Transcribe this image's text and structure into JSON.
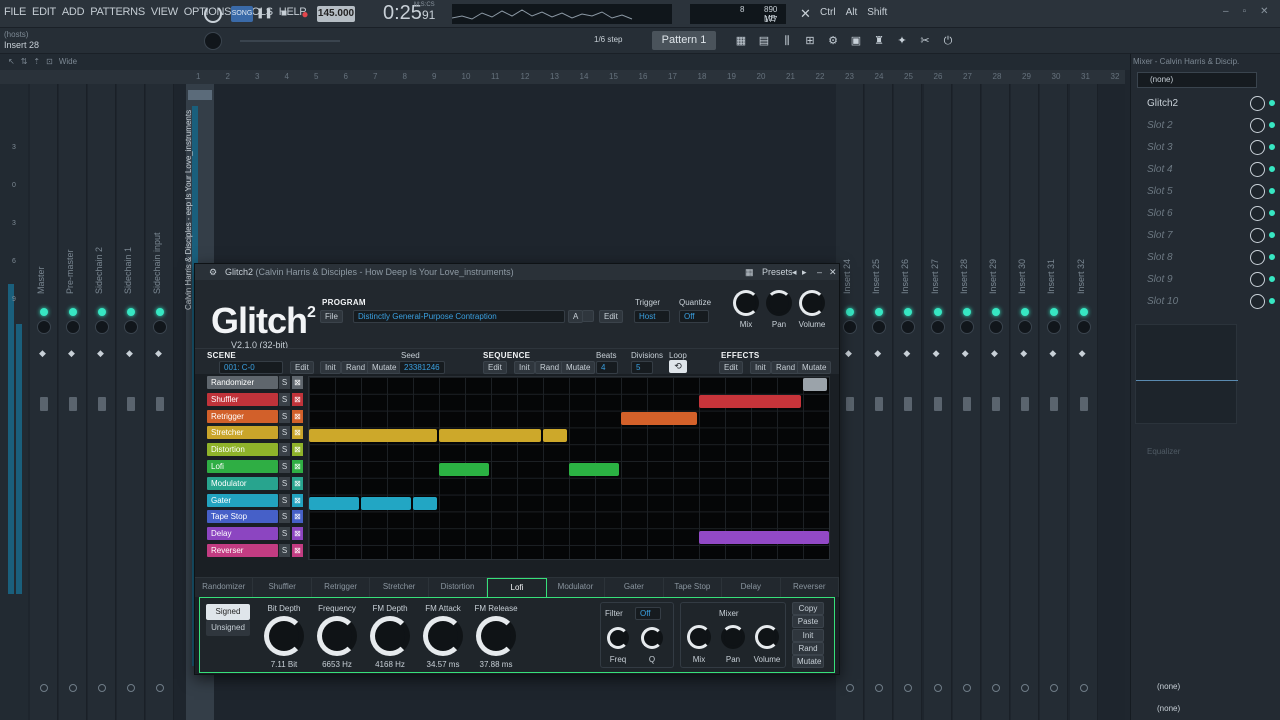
{
  "menu": [
    "FILE",
    "EDIT",
    "ADD",
    "PATTERNS",
    "VIEW",
    "OPTIONS",
    "TOOLS",
    "HELP"
  ],
  "transport": {
    "tempo": "145.000",
    "time": "0:25",
    "time_sub": "91",
    "time_label": "M:S:CS",
    "ram": "890 MB",
    "ram_sub": "177",
    "cpu_val": "8",
    "mode": "SONG"
  },
  "modifiers": [
    "Ctrl",
    "Alt",
    "Shift"
  ],
  "hint": {
    "line1": "(hosts)",
    "line2": "Insert 28"
  },
  "snap": "1/6 step",
  "pattern": "Pattern 1",
  "wide": "Wide",
  "ruler": [
    "1",
    "2",
    "3",
    "4",
    "5",
    "6",
    "7",
    "8",
    "9",
    "10",
    "11",
    "12",
    "13",
    "14",
    "15",
    "16",
    "17",
    "18",
    "19",
    "20",
    "21",
    "22",
    "23",
    "24",
    "25",
    "26",
    "27",
    "28",
    "29",
    "30",
    "31",
    "32"
  ],
  "mixer": {
    "left_names": [
      "Master",
      "Pre-master",
      "Sidechain 2",
      "Sidechain 1",
      "Sidechain input"
    ],
    "right_names": [
      "Insert 24",
      "Insert 25",
      "Insert 26",
      "Insert 27",
      "Insert 28",
      "Insert 29",
      "Insert 30",
      "Insert 31",
      "Insert 32"
    ],
    "vtext": "Calvin Harris & Disciples - eep Is Your Love_instruments",
    "scale": [
      "3",
      "0",
      "3",
      "6",
      "9"
    ]
  },
  "rpanel": {
    "title": "Mixer - Calvin Harris & Discip.",
    "preset": "(none)",
    "slots": [
      "Glitch2",
      "Slot 2",
      "Slot 3",
      "Slot 4",
      "Slot 5",
      "Slot 6",
      "Slot 7",
      "Slot 8",
      "Slot 9",
      "Slot 10"
    ],
    "eq": "Equalizer",
    "out1": "(none)",
    "out2": "(none)"
  },
  "plugin": {
    "title": "Glitch2",
    "title_sub": "(Calvin Harris & Disciples - How Deep Is Your Love_instruments)",
    "presets": "Presets",
    "logo": "Glitch",
    "logo_sup": "2",
    "version": "V2.1.0 (32-bit)",
    "program_label": "PROGRAM",
    "file": "File",
    "program_name": "Distinctly General-Purpose Contraption",
    "a": "A",
    "edit": "Edit",
    "trigger_label": "Trigger",
    "trigger": "Host",
    "quantize_label": "Quantize",
    "quantize": "Off",
    "mix": "Mix",
    "pan": "Pan",
    "volume": "Volume",
    "scene_label": "SCENE",
    "scene_val": "001: C-0",
    "seed_label": "Seed",
    "seed": "23381246",
    "init": "Init",
    "rand": "Rand",
    "mutate": "Mutate",
    "sequence_label": "SEQUENCE",
    "beats_label": "Beats",
    "beats": "4",
    "divisions_label": "Divisions",
    "divisions": "5",
    "loop_label": "Loop",
    "effects_label": "EFFECTS",
    "tracks": [
      {
        "name": "Randomizer",
        "color": "#5f666d"
      },
      {
        "name": "Shuffler",
        "color": "#c0333a"
      },
      {
        "name": "Retrigger",
        "color": "#d2602a"
      },
      {
        "name": "Stretcher",
        "color": "#c9a52a"
      },
      {
        "name": "Distortion",
        "color": "#8fb32a"
      },
      {
        "name": "Lofi",
        "color": "#2fae44"
      },
      {
        "name": "Modulator",
        "color": "#28a48e"
      },
      {
        "name": "Gater",
        "color": "#22a3c0"
      },
      {
        "name": "Tape Stop",
        "color": "#4660c8"
      },
      {
        "name": "Delay",
        "color": "#8c45c1"
      },
      {
        "name": "Reverser",
        "color": "#c23c82"
      }
    ],
    "s": "S",
    "tabs": [
      "Randomizer",
      "Shuffler",
      "Retrigger",
      "Stretcher",
      "Distortion",
      "Lofi",
      "Modulator",
      "Gater",
      "Tape Stop",
      "Delay",
      "Reverser"
    ],
    "active_tab": "Lofi",
    "signed": "Signed",
    "unsigned": "Unsigned",
    "lofi": [
      {
        "label": "Bit Depth",
        "value": "7.11 Bit"
      },
      {
        "label": "Frequency",
        "value": "6653 Hz"
      },
      {
        "label": "FM Depth",
        "value": "4168 Hz"
      },
      {
        "label": "FM Attack",
        "value": "34.57 ms"
      },
      {
        "label": "FM Release",
        "value": "37.88 ms"
      }
    ],
    "filter_label": "Filter",
    "filter": "Off",
    "freq": "Freq",
    "q": "Q",
    "mixer_label": "Mixer",
    "side": [
      "Copy",
      "Paste",
      "Init",
      "Rand",
      "Mutate"
    ]
  }
}
